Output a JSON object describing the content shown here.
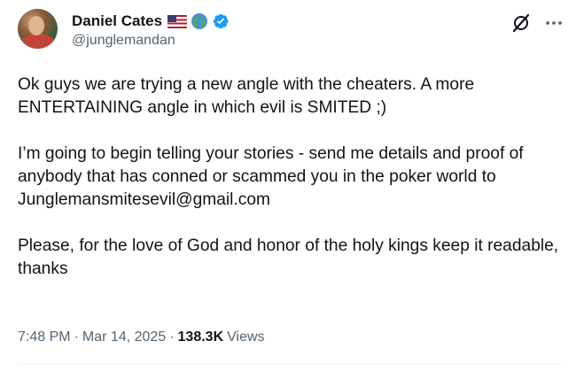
{
  "author": {
    "display_name": "Daniel Cates",
    "handle": "@junglemandan",
    "badges": [
      "us-flag-icon",
      "globe-icon",
      "verified-badge-icon"
    ],
    "verified_color": "#1d9bf0"
  },
  "actions": {
    "grok_icon": "grok-icon",
    "more_icon": "more-options-icon"
  },
  "body": {
    "paragraphs": [
      "Ok guys we are trying a new angle with the cheaters. A more ENTERTAINING angle in which evil is SMITED ;)",
      "I’m going to begin telling your stories - send me details and proof of anybody that has conned or scammed you in the poker world to Junglemansmitesevil@gmail.com",
      "Please, for the love of God and honor of the holy kings keep it readable, thanks"
    ]
  },
  "meta": {
    "time": "7:48 PM",
    "separator": "·",
    "date": "Mar 14, 2025",
    "views_count": "138.3K",
    "views_label": "Views"
  },
  "colors": {
    "text": "#0f1419",
    "secondary": "#536471",
    "background": "#ffffff"
  }
}
